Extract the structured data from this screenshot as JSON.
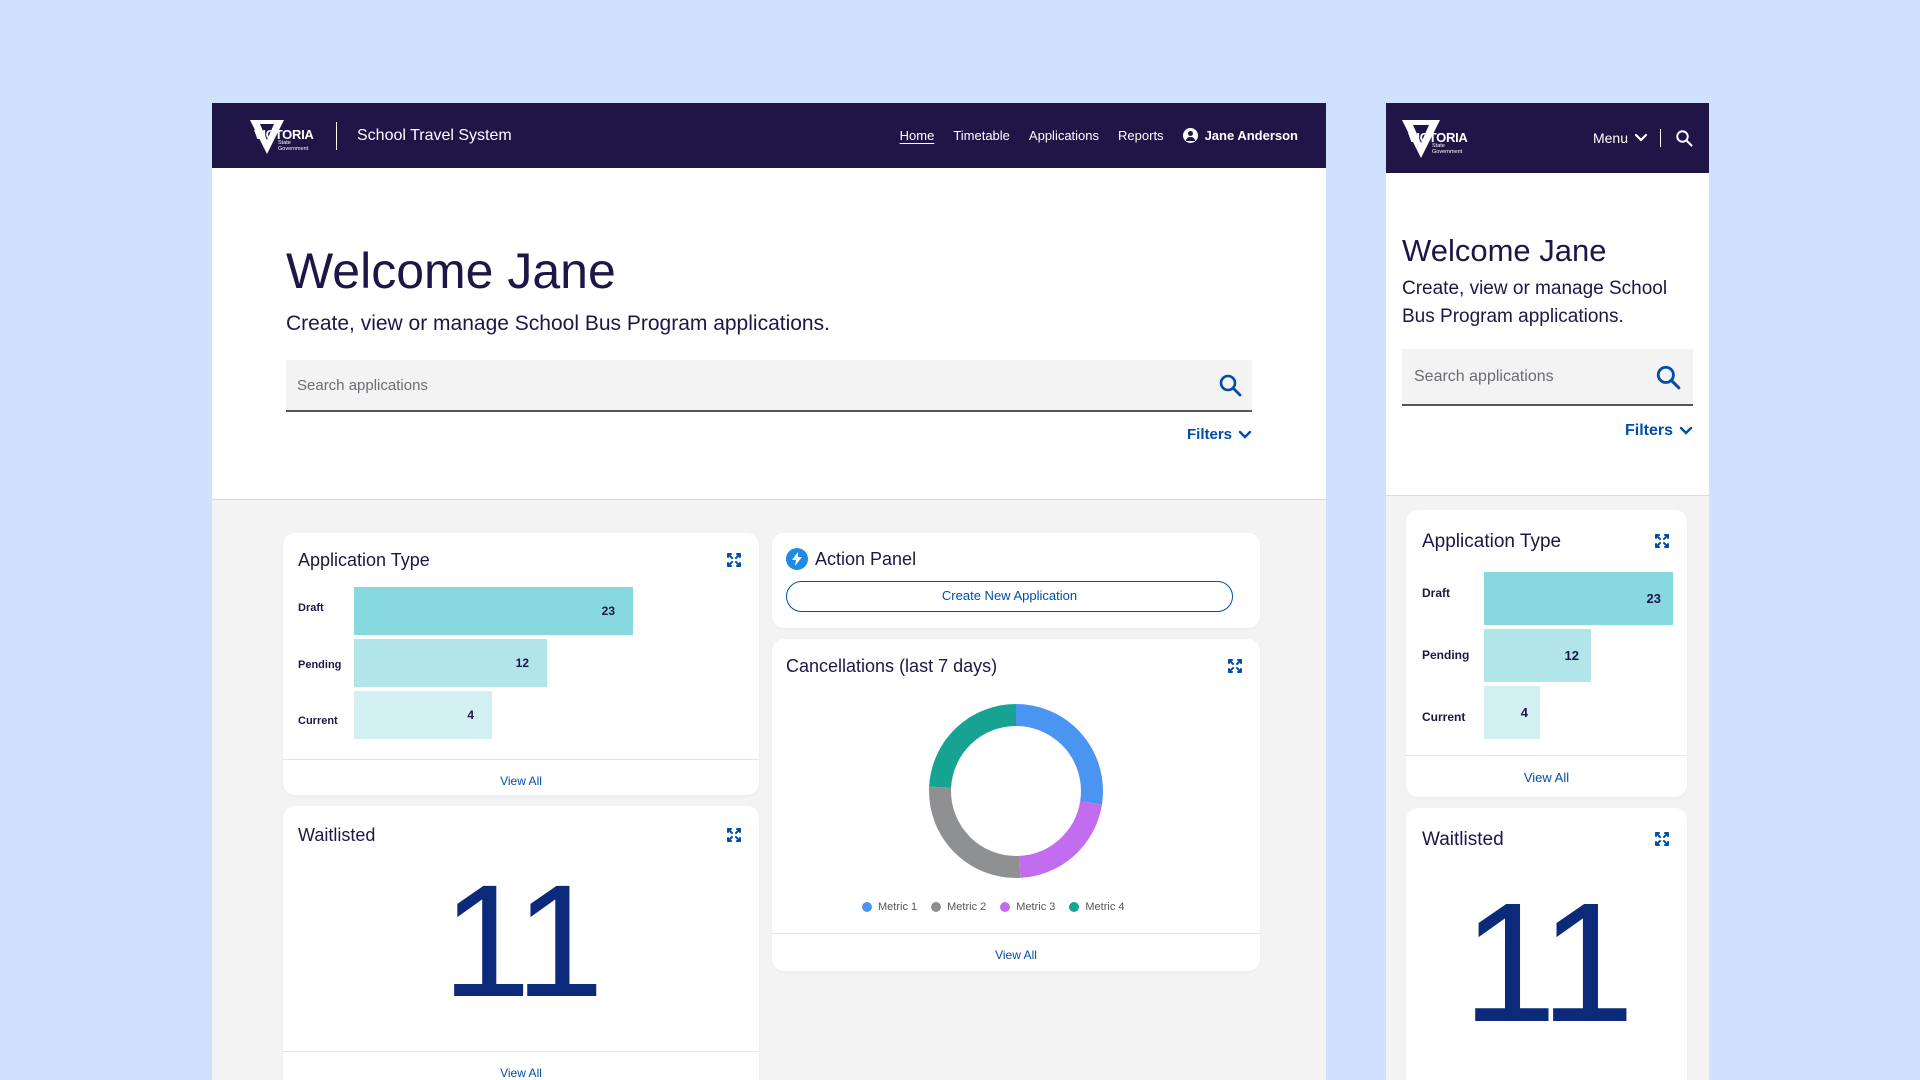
{
  "brand": {
    "logo_word": "VICTORIA",
    "logo_sub1": "State",
    "logo_sub2": "Government",
    "app_title": "School Travel System"
  },
  "nav": {
    "items": [
      {
        "label": "Home",
        "active": true
      },
      {
        "label": "Timetable"
      },
      {
        "label": "Applications"
      },
      {
        "label": "Reports"
      }
    ],
    "user": "Jane Anderson"
  },
  "mobile_nav": {
    "menu_label": "Menu"
  },
  "hero": {
    "title": "Welcome Jane",
    "subtitle": "Create, view or manage School Bus Program applications.",
    "search_placeholder": "Search applications",
    "filters_label": "Filters"
  },
  "application_type": {
    "title": "Application Type",
    "view_all": "View All",
    "bars": [
      {
        "label": "Draft",
        "value": 23,
        "color": "#87d8df"
      },
      {
        "label": "Pending",
        "value": 12,
        "color": "#b1e5ea"
      },
      {
        "label": "Current",
        "value": 4,
        "color": "#d2eff2"
      }
    ]
  },
  "action_panel": {
    "title": "Action Panel",
    "button": "Create New Application"
  },
  "cancellations": {
    "title": "Cancellations (last 7 days)",
    "view_all": "View All",
    "legend": [
      {
        "label": "Metric 1",
        "color": "#4a94f2"
      },
      {
        "label": "Metric 2",
        "color": "#8f9092"
      },
      {
        "label": "Metric 3",
        "color": "#c26cf0"
      },
      {
        "label": "Metric 4",
        "color": "#16a391"
      }
    ]
  },
  "waitlisted": {
    "title": "Waitlisted",
    "value": "11",
    "view_all": "View All"
  },
  "chart_data": {
    "type": "bar",
    "title": "Application Type",
    "categories": [
      "Draft",
      "Pending",
      "Current"
    ],
    "values": [
      23,
      12,
      4
    ],
    "orientation": "horizontal",
    "grid": false
  },
  "colors": {
    "navy": "#201547",
    "link": "#004ea8",
    "background": "#d0e1fd",
    "big_number": "#0b2a7a"
  }
}
